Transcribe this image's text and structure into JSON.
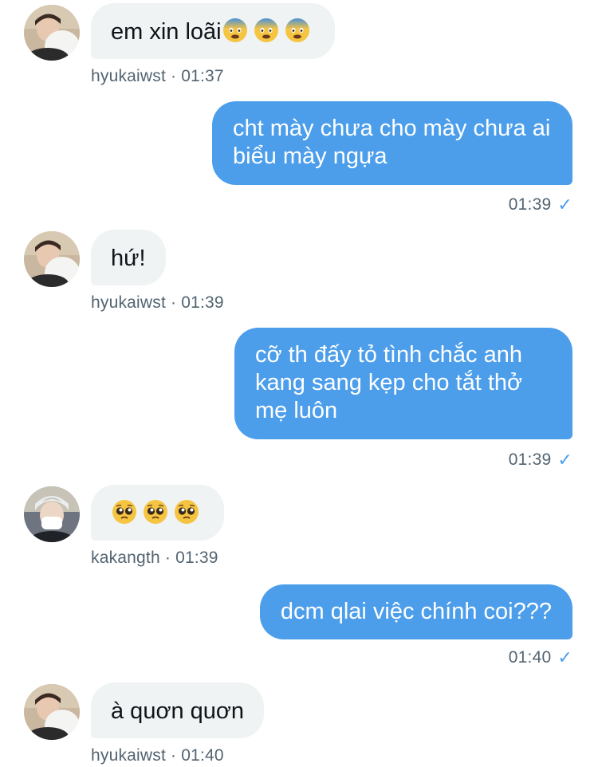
{
  "colors": {
    "incoming_bubble": "#eff3f4",
    "outgoing_bubble": "#4c9eeb",
    "meta_text": "#536471",
    "read_check": "#4c9eeb"
  },
  "messages": [
    {
      "direction": "in",
      "text": "em xin loãi",
      "emoji": [
        "fearful-face-emoji",
        "fearful-face-emoji",
        "fearful-face-emoji"
      ],
      "meta": "hyukaiwst · 01:37",
      "avatar": "hyuka-avatar"
    },
    {
      "direction": "out",
      "text": "cht mày chưa cho mày chưa ai biểu mày ngựa",
      "meta": "01:39",
      "status_icon": "check-icon"
    },
    {
      "direction": "in",
      "text": "hứ!",
      "meta": "hyukaiwst · 01:39",
      "avatar": "hyuka-avatar"
    },
    {
      "direction": "out",
      "text": "cỡ th đấy tỏ tình chắc anh kang sang kẹp cho tắt thở mẹ luôn",
      "meta": "01:39",
      "status_icon": "check-icon"
    },
    {
      "direction": "in",
      "text": "",
      "emoji": [
        "pleading-face-emoji",
        "pleading-face-emoji",
        "pleading-face-emoji"
      ],
      "meta": "kakangth · 01:39",
      "avatar": "kakang-avatar"
    },
    {
      "direction": "out",
      "text": "dcm qlai việc chính coi???",
      "meta": "01:40",
      "status_icon": "check-icon"
    },
    {
      "direction": "in",
      "text": "à quơn quơn",
      "meta": "hyukaiwst · 01:40",
      "avatar": "hyuka-avatar"
    }
  ]
}
